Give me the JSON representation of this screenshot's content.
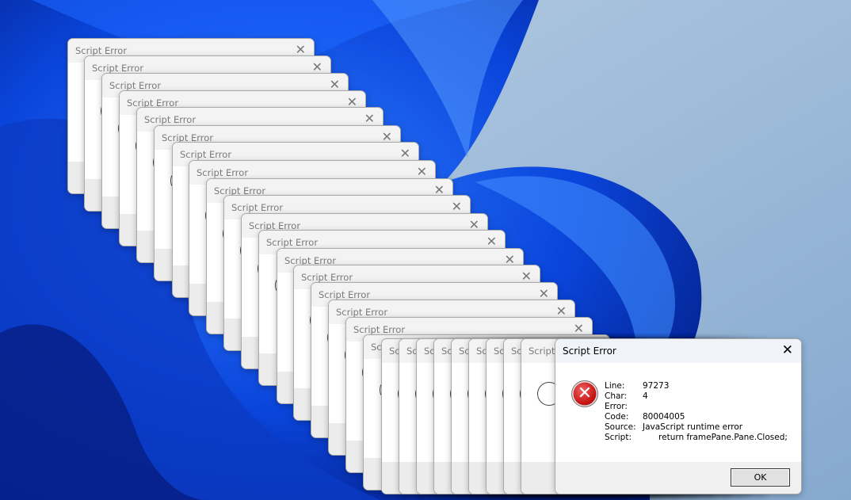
{
  "cascade": {
    "title": "Script Error",
    "close_glyph": "✕"
  },
  "front_dialog": {
    "title": "Script Error",
    "close_glyph": "✕",
    "icon": "error-icon",
    "fields": [
      {
        "label": "Line:",
        "value": "97273"
      },
      {
        "label": "Char:",
        "value": "4"
      },
      {
        "label": "Error:",
        "value": ""
      },
      {
        "label": "Code:",
        "value": "80004005"
      },
      {
        "label": "Source:",
        "value": "JavaScript runtime error"
      },
      {
        "label": "Script:",
        "value": "      return framePane.Pane.Closed;"
      }
    ],
    "ok_label": "OK"
  },
  "colors": {
    "error_red": "#c41414",
    "wallpaper_blue": "#0a3fd0"
  }
}
